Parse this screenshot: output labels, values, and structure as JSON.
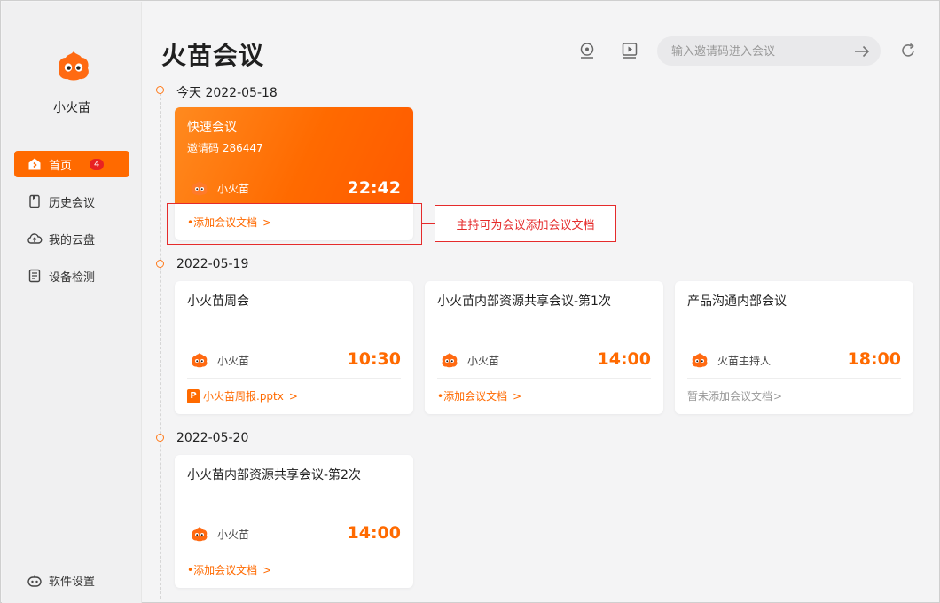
{
  "sidebar": {
    "username": "小火苗",
    "items": [
      {
        "label": "首页",
        "badge": "4",
        "icon": "home-icon",
        "active": true
      },
      {
        "label": "历史会议",
        "icon": "history-icon"
      },
      {
        "label": "我的云盘",
        "icon": "cloud-icon"
      },
      {
        "label": "设备检测",
        "icon": "device-check-icon"
      }
    ],
    "settings_label": "软件设置"
  },
  "header": {
    "title": "火苗会议",
    "search_placeholder": "输入邀请码进入会议"
  },
  "timeline": [
    {
      "date": "今天 2022-05-18",
      "cards": [
        {
          "title": "快速会议",
          "invite_code": "邀请码 286447",
          "host": "小火苗",
          "time": "22:42",
          "doc_label": "添加会议文档",
          "highlight": true
        }
      ]
    },
    {
      "date": "2022-05-19",
      "cards": [
        {
          "title": "小火苗周会",
          "host": "小火苗",
          "time": "10:30",
          "doc_label": "小火苗周报.pptx",
          "doc_type": "pptx"
        },
        {
          "title": "小火苗内部资源共享会议-第1次",
          "host": "小火苗",
          "time": "14:00",
          "doc_label": "添加会议文档"
        },
        {
          "title": "产品沟通内部会议",
          "host": "火苗主持人",
          "time": "18:00",
          "doc_label": "暂未添加会议文档",
          "doc_empty": true
        }
      ]
    },
    {
      "date": "2022-05-20",
      "cards": [
        {
          "title": "小火苗内部资源共享会议-第2次",
          "host": "小火苗",
          "time": "14:00",
          "doc_label": "添加会议文档"
        }
      ]
    }
  ],
  "annotation": {
    "callout_text": "主持可为会议添加会议文档"
  },
  "colors": {
    "accent": "#ff6a00",
    "badge": "#e82222",
    "annotation": "#e52b2b"
  }
}
